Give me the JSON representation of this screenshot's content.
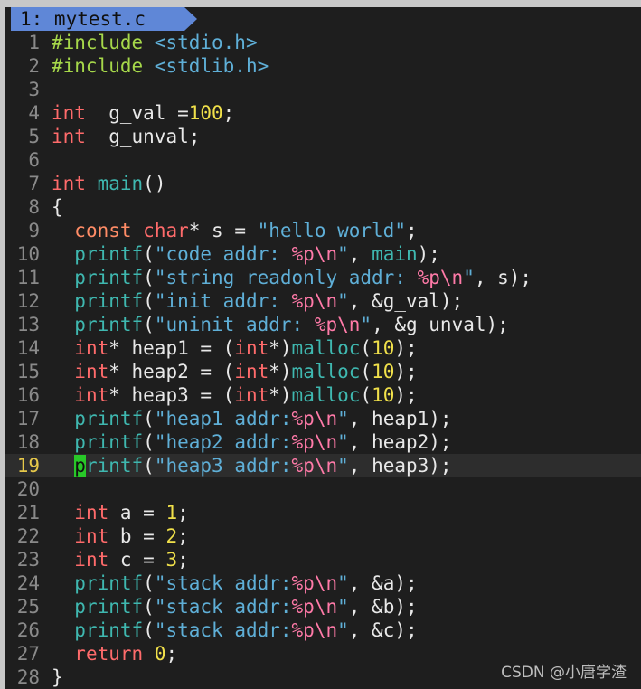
{
  "tab": {
    "label": "1: mytest.c"
  },
  "watermark": "CSDN @小唐学渣",
  "colors": {
    "tab_bg": "#5f87d7",
    "editor_bg": "#1e1e1e",
    "cursor": "#28c828"
  },
  "cursor_line": 19,
  "lines": [
    {
      "n": "1",
      "t": [
        [
          "pre",
          "#include "
        ],
        [
          "inc",
          "<stdio.h>"
        ]
      ]
    },
    {
      "n": "2",
      "t": [
        [
          "pre",
          "#include "
        ],
        [
          "inc",
          "<stdlib.h>"
        ]
      ]
    },
    {
      "n": "3",
      "t": []
    },
    {
      "n": "4",
      "t": [
        [
          "kw",
          "int"
        ],
        [
          "",
          "  g_val ="
        ],
        [
          "num-lit",
          "100"
        ],
        [
          "",
          ";"
        ]
      ]
    },
    {
      "n": "5",
      "t": [
        [
          "kw",
          "int"
        ],
        [
          "",
          "  g_unval;"
        ]
      ]
    },
    {
      "n": "6",
      "t": []
    },
    {
      "n": "7",
      "t": [
        [
          "kw",
          "int"
        ],
        [
          "",
          " "
        ],
        [
          "fn",
          "main"
        ],
        [
          "",
          "()"
        ]
      ]
    },
    {
      "n": "8",
      "t": [
        [
          "",
          "{"
        ]
      ]
    },
    {
      "n": "9",
      "t": [
        [
          "",
          "  "
        ],
        [
          "kw2",
          "const"
        ],
        [
          "",
          " "
        ],
        [
          "kw",
          "char"
        ],
        [
          "",
          "* s = "
        ],
        [
          "str",
          "\"hello world\""
        ],
        [
          "",
          ";"
        ]
      ]
    },
    {
      "n": "10",
      "t": [
        [
          "",
          "  "
        ],
        [
          "fn",
          "printf"
        ],
        [
          "",
          "("
        ],
        [
          "str",
          "\"code addr: "
        ],
        [
          "fmt",
          "%p\\n"
        ],
        [
          "str",
          "\""
        ],
        [
          "",
          ", "
        ],
        [
          "fn",
          "main"
        ],
        [
          "",
          ");"
        ]
      ]
    },
    {
      "n": "11",
      "t": [
        [
          "",
          "  "
        ],
        [
          "fn",
          "printf"
        ],
        [
          "",
          "("
        ],
        [
          "str",
          "\"string readonly addr: "
        ],
        [
          "fmt",
          "%p\\n"
        ],
        [
          "str",
          "\""
        ],
        [
          "",
          ", s);"
        ]
      ]
    },
    {
      "n": "12",
      "t": [
        [
          "",
          "  "
        ],
        [
          "fn",
          "printf"
        ],
        [
          "",
          "("
        ],
        [
          "str",
          "\"init addr: "
        ],
        [
          "fmt",
          "%p\\n"
        ],
        [
          "str",
          "\""
        ],
        [
          "",
          ", &g_val);"
        ]
      ]
    },
    {
      "n": "13",
      "t": [
        [
          "",
          "  "
        ],
        [
          "fn",
          "printf"
        ],
        [
          "",
          "("
        ],
        [
          "str",
          "\"uninit addr: "
        ],
        [
          "fmt",
          "%p\\n"
        ],
        [
          "str",
          "\""
        ],
        [
          "",
          ", &g_unval);"
        ]
      ]
    },
    {
      "n": "14",
      "t": [
        [
          "",
          "  "
        ],
        [
          "kw",
          "int"
        ],
        [
          "",
          "* heap1 = ("
        ],
        [
          "kw",
          "int"
        ],
        [
          "",
          "*)"
        ],
        [
          "fn",
          "malloc"
        ],
        [
          "",
          "("
        ],
        [
          "num-lit",
          "10"
        ],
        [
          "",
          ");"
        ]
      ]
    },
    {
      "n": "15",
      "t": [
        [
          "",
          "  "
        ],
        [
          "kw",
          "int"
        ],
        [
          "",
          "* heap2 = ("
        ],
        [
          "kw",
          "int"
        ],
        [
          "",
          "*)"
        ],
        [
          "fn",
          "malloc"
        ],
        [
          "",
          "("
        ],
        [
          "num-lit",
          "10"
        ],
        [
          "",
          ");"
        ]
      ]
    },
    {
      "n": "16",
      "t": [
        [
          "",
          "  "
        ],
        [
          "kw",
          "int"
        ],
        [
          "",
          "* heap3 = ("
        ],
        [
          "kw",
          "int"
        ],
        [
          "",
          "*)"
        ],
        [
          "fn",
          "malloc"
        ],
        [
          "",
          "("
        ],
        [
          "num-lit",
          "10"
        ],
        [
          "",
          ");"
        ]
      ]
    },
    {
      "n": "17",
      "t": [
        [
          "",
          "  "
        ],
        [
          "fn",
          "printf"
        ],
        [
          "",
          "("
        ],
        [
          "str",
          "\"heap1 addr:"
        ],
        [
          "fmt",
          "%p\\n"
        ],
        [
          "str",
          "\""
        ],
        [
          "",
          ", heap1);"
        ]
      ]
    },
    {
      "n": "18",
      "t": [
        [
          "",
          "  "
        ],
        [
          "fn",
          "printf"
        ],
        [
          "",
          "("
        ],
        [
          "str",
          "\"heap2 addr:"
        ],
        [
          "fmt",
          "%p\\n"
        ],
        [
          "str",
          "\""
        ],
        [
          "",
          ", heap2);"
        ]
      ]
    },
    {
      "n": "19",
      "t": [
        [
          "",
          "  "
        ],
        [
          "cursor",
          "p"
        ],
        [
          "fn",
          "rintf"
        ],
        [
          "",
          "("
        ],
        [
          "str",
          "\"heap3 addr:"
        ],
        [
          "fmt",
          "%p\\n"
        ],
        [
          "str",
          "\""
        ],
        [
          "",
          ", heap3);"
        ]
      ]
    },
    {
      "n": "20",
      "t": []
    },
    {
      "n": "21",
      "t": [
        [
          "",
          "  "
        ],
        [
          "kw",
          "int"
        ],
        [
          "",
          " a = "
        ],
        [
          "num-lit",
          "1"
        ],
        [
          "",
          ";"
        ]
      ]
    },
    {
      "n": "22",
      "t": [
        [
          "",
          "  "
        ],
        [
          "kw",
          "int"
        ],
        [
          "",
          " b = "
        ],
        [
          "num-lit",
          "2"
        ],
        [
          "",
          ";"
        ]
      ]
    },
    {
      "n": "23",
      "t": [
        [
          "",
          "  "
        ],
        [
          "kw",
          "int"
        ],
        [
          "",
          " c = "
        ],
        [
          "num-lit",
          "3"
        ],
        [
          "",
          ";"
        ]
      ]
    },
    {
      "n": "24",
      "t": [
        [
          "",
          "  "
        ],
        [
          "fn",
          "printf"
        ],
        [
          "",
          "("
        ],
        [
          "str",
          "\"stack addr:"
        ],
        [
          "fmt",
          "%p\\n"
        ],
        [
          "str",
          "\""
        ],
        [
          "",
          ", &a);"
        ]
      ]
    },
    {
      "n": "25",
      "t": [
        [
          "",
          "  "
        ],
        [
          "fn",
          "printf"
        ],
        [
          "",
          "("
        ],
        [
          "str",
          "\"stack addr:"
        ],
        [
          "fmt",
          "%p\\n"
        ],
        [
          "str",
          "\""
        ],
        [
          "",
          ", &b);"
        ]
      ]
    },
    {
      "n": "26",
      "t": [
        [
          "",
          "  "
        ],
        [
          "fn",
          "printf"
        ],
        [
          "",
          "("
        ],
        [
          "str",
          "\"stack addr:"
        ],
        [
          "fmt",
          "%p\\n"
        ],
        [
          "str",
          "\""
        ],
        [
          "",
          ", &c);"
        ]
      ]
    },
    {
      "n": "27",
      "t": [
        [
          "",
          "  "
        ],
        [
          "kw",
          "return"
        ],
        [
          "",
          " "
        ],
        [
          "num-lit",
          "0"
        ],
        [
          "",
          ";"
        ]
      ]
    },
    {
      "n": "28",
      "t": [
        [
          "",
          "}"
        ]
      ]
    }
  ]
}
